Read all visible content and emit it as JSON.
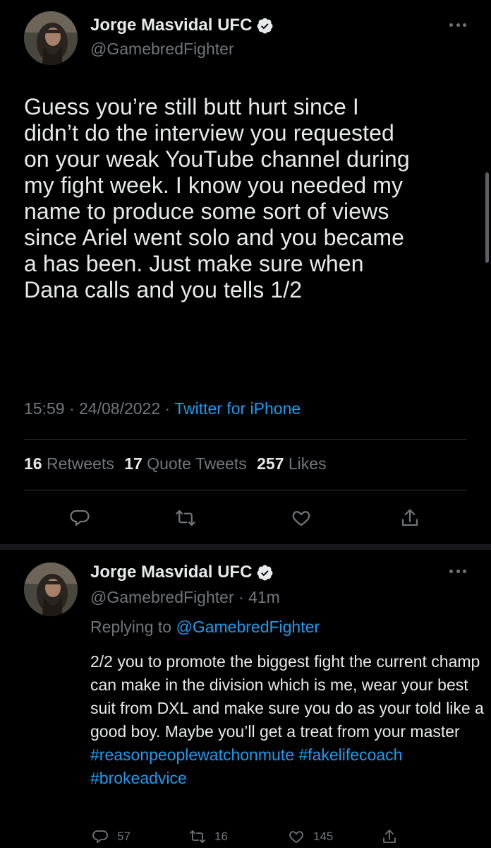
{
  "main_tweet": {
    "author_name": "Jorge Masvidal UFC",
    "handle": "@GamebredFighter",
    "text": "Guess you’re still butt hurt since I\ndidn’t do the interview you requested\non your weak YouTube channel during\nmy fight week. I know you needed my\nname to produce some sort of views\nsince Ariel went solo and you became\na has been. Just make sure when\nDana calls and you tells 1/2",
    "time": "15:59",
    "date": "24/08/2022",
    "sep": "·",
    "source": "Twitter for iPhone",
    "retweets_count": "16",
    "retweets_label": "Retweets",
    "quotes_count": "17",
    "quotes_label": "Quote Tweets",
    "likes_count": "257",
    "likes_label": "Likes",
    "actions": [
      "reply-icon",
      "retweet-icon",
      "like-icon",
      "share-icon"
    ]
  },
  "reply_tweet": {
    "author_name": "Jorge Masvidal UFC",
    "handle": "@GamebredFighter",
    "age_sep": " · ",
    "age": "41m",
    "replying_label": "Replying to",
    "replying_handle": "@GamebredFighter",
    "text": "2/2 you to promote the biggest fight the current champ can make in the division which is me, wear your best suit from DXL and make sure you do as your told like a good boy. Maybe you’ll get a treat from your master",
    "hashtags": [
      "#reasonpeoplewatchonmute",
      "#fakelifecoach",
      "#brokeadvice"
    ],
    "reply_count": "57",
    "retweet_count": "16",
    "like_count": "145"
  },
  "colors": {
    "background": "#000000",
    "text": "#e7e9ea",
    "secondary": "#71767b",
    "accent": "#1d9bf0",
    "divider": "#2f3336"
  }
}
